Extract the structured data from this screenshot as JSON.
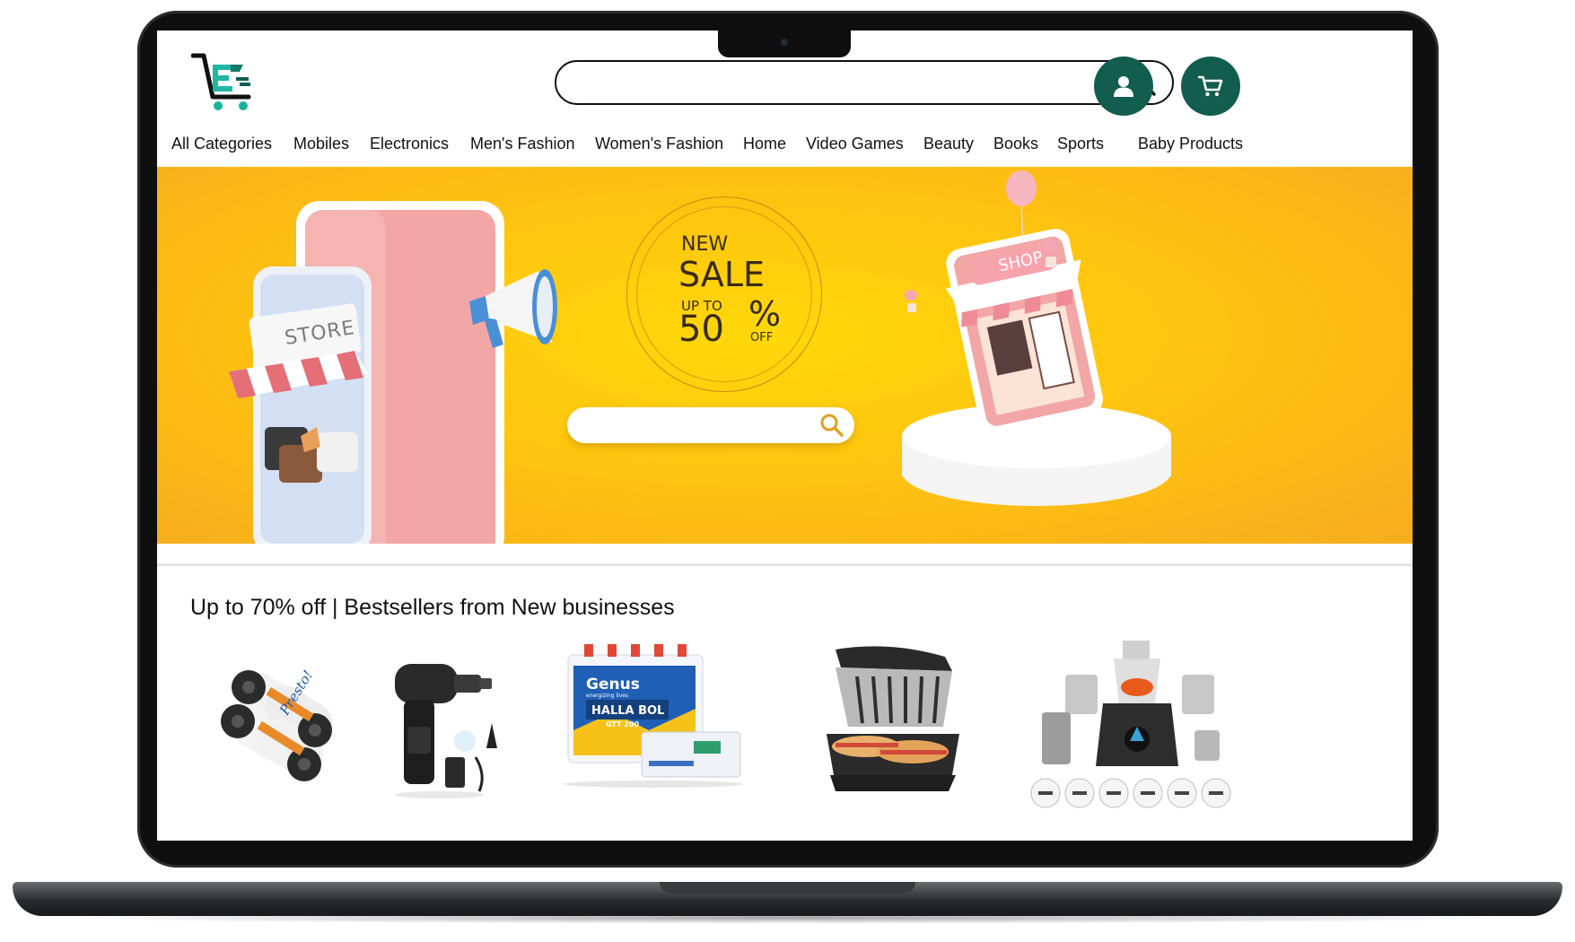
{
  "header": {
    "logo_icon": "shopping-cart-letter-e-logo",
    "search": {
      "placeholder": "",
      "icon": "search-icon"
    },
    "account_icon": "user-icon",
    "cart_icon": "cart-icon",
    "accent_color": "#125d4e"
  },
  "nav": {
    "items": [
      {
        "label": "All Categories"
      },
      {
        "label": "Mobiles"
      },
      {
        "label": "Electronics"
      },
      {
        "label": "Men's Fashion"
      },
      {
        "label": "Women's Fashion"
      },
      {
        "label": "Home"
      },
      {
        "label": "Video Games"
      },
      {
        "label": "Beauty"
      },
      {
        "label": "Books"
      },
      {
        "label": "Sports"
      },
      {
        "label": "Baby Products"
      }
    ]
  },
  "hero": {
    "background_color": "#ffc40f",
    "store_sign": "STORE",
    "sale_new": "NEW",
    "sale_title": "SALE",
    "sale_upto": "UP TO",
    "sale_percent": "50",
    "sale_percent_sign": "%",
    "sale_off": "OFF",
    "shop_sign": "SHOP",
    "search_icon": "search-icon"
  },
  "bestsellers": {
    "title": "Up to 70% off | Bestsellers from New businesses",
    "products": [
      {
        "name": "garbage-bags-rolls",
        "brand_text": "Presto!"
      },
      {
        "name": "cordless-air-blower"
      },
      {
        "name": "inverter-battery",
        "brand_text": "Genus",
        "tagline": "energizing lives",
        "model_text": "HALLA BOL",
        "model_code": "GTT 200"
      },
      {
        "name": "sandwich-grill"
      },
      {
        "name": "mixer-grinder"
      }
    ]
  }
}
